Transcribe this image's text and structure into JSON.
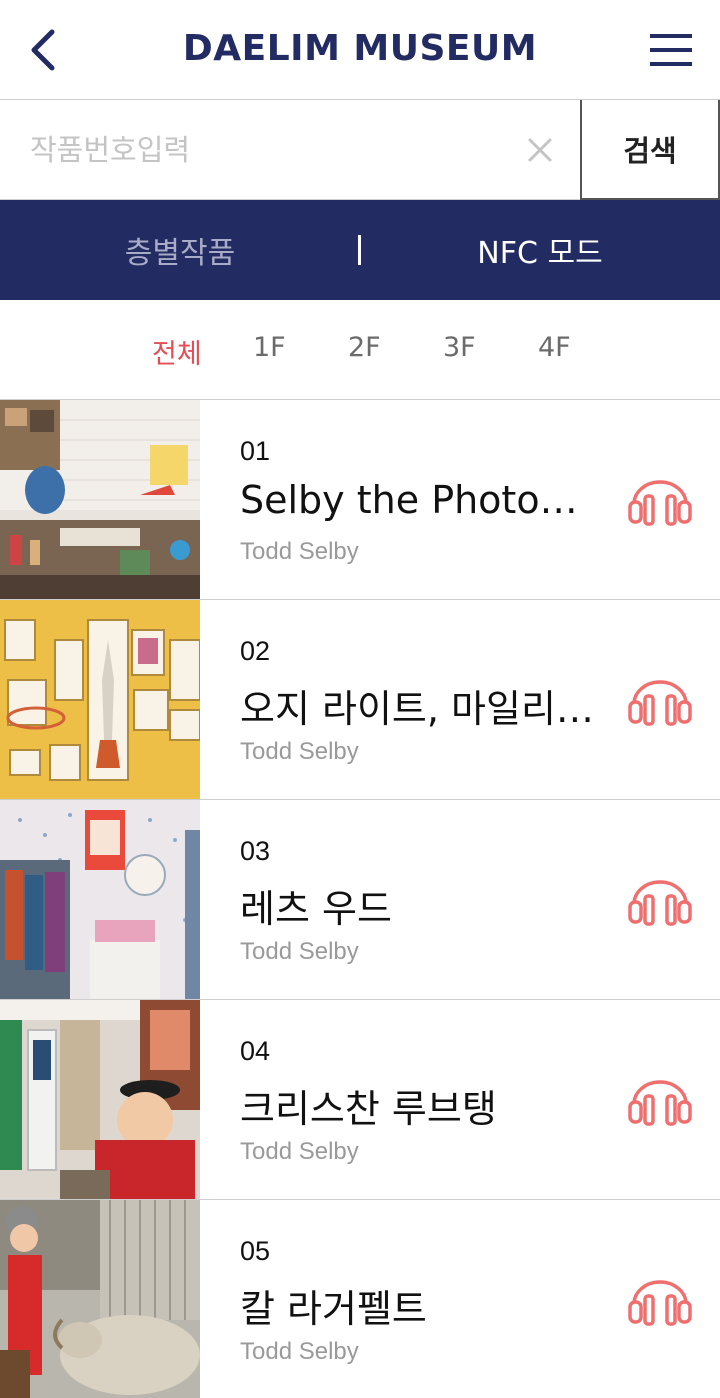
{
  "header": {
    "brand": "DAELIM MUSEUM",
    "back_icon": "chevron-left-icon",
    "menu_icon": "hamburger-menu-icon"
  },
  "search": {
    "placeholder": "작품번호입력",
    "value": "",
    "clear_icon": "close-icon",
    "button_label": "검색"
  },
  "mode_tabs": [
    {
      "label": "층별작품",
      "active": false
    },
    {
      "label": "NFC 모드",
      "active": true
    }
  ],
  "floor_tabs": [
    {
      "label": "전체",
      "active": true
    },
    {
      "label": "1F",
      "active": false
    },
    {
      "label": "2F",
      "active": false
    },
    {
      "label": "3F",
      "active": false
    },
    {
      "label": "4F",
      "active": false
    }
  ],
  "artworks": [
    {
      "number": "01",
      "title": "Selby the Photo…",
      "artist": "Todd Selby"
    },
    {
      "number": "02",
      "title": "오지 라이트, 마일리…",
      "artist": "Todd Selby"
    },
    {
      "number": "03",
      "title": "레츠 우드",
      "artist": "Todd Selby"
    },
    {
      "number": "04",
      "title": "크리스찬 루브탱",
      "artist": "Todd Selby"
    },
    {
      "number": "05",
      "title": "칼 라거펠트",
      "artist": "Todd Selby"
    }
  ],
  "colors": {
    "navy": "#232b63",
    "accent_red": "#e54d56",
    "headphone": "#ef6f6f",
    "muted_text": "#9a9a9a"
  },
  "audio_icon": "headphones-icon"
}
